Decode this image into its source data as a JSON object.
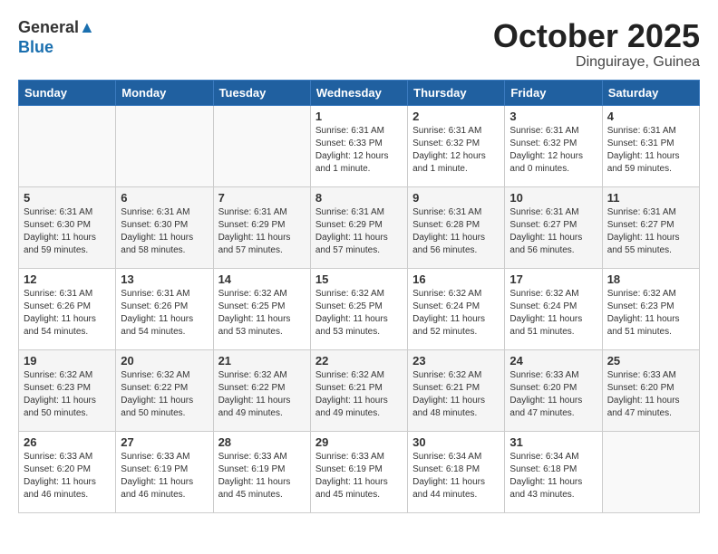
{
  "header": {
    "logo_general": "General",
    "logo_blue": "Blue",
    "month": "October 2025",
    "location": "Dinguiraye, Guinea"
  },
  "weekdays": [
    "Sunday",
    "Monday",
    "Tuesday",
    "Wednesday",
    "Thursday",
    "Friday",
    "Saturday"
  ],
  "weeks": [
    [
      {
        "day": "",
        "content": ""
      },
      {
        "day": "",
        "content": ""
      },
      {
        "day": "",
        "content": ""
      },
      {
        "day": "1",
        "content": "Sunrise: 6:31 AM\nSunset: 6:33 PM\nDaylight: 12 hours\nand 1 minute."
      },
      {
        "day": "2",
        "content": "Sunrise: 6:31 AM\nSunset: 6:32 PM\nDaylight: 12 hours\nand 1 minute."
      },
      {
        "day": "3",
        "content": "Sunrise: 6:31 AM\nSunset: 6:32 PM\nDaylight: 12 hours\nand 0 minutes."
      },
      {
        "day": "4",
        "content": "Sunrise: 6:31 AM\nSunset: 6:31 PM\nDaylight: 11 hours\nand 59 minutes."
      }
    ],
    [
      {
        "day": "5",
        "content": "Sunrise: 6:31 AM\nSunset: 6:30 PM\nDaylight: 11 hours\nand 59 minutes."
      },
      {
        "day": "6",
        "content": "Sunrise: 6:31 AM\nSunset: 6:30 PM\nDaylight: 11 hours\nand 58 minutes."
      },
      {
        "day": "7",
        "content": "Sunrise: 6:31 AM\nSunset: 6:29 PM\nDaylight: 11 hours\nand 57 minutes."
      },
      {
        "day": "8",
        "content": "Sunrise: 6:31 AM\nSunset: 6:29 PM\nDaylight: 11 hours\nand 57 minutes."
      },
      {
        "day": "9",
        "content": "Sunrise: 6:31 AM\nSunset: 6:28 PM\nDaylight: 11 hours\nand 56 minutes."
      },
      {
        "day": "10",
        "content": "Sunrise: 6:31 AM\nSunset: 6:27 PM\nDaylight: 11 hours\nand 56 minutes."
      },
      {
        "day": "11",
        "content": "Sunrise: 6:31 AM\nSunset: 6:27 PM\nDaylight: 11 hours\nand 55 minutes."
      }
    ],
    [
      {
        "day": "12",
        "content": "Sunrise: 6:31 AM\nSunset: 6:26 PM\nDaylight: 11 hours\nand 54 minutes."
      },
      {
        "day": "13",
        "content": "Sunrise: 6:31 AM\nSunset: 6:26 PM\nDaylight: 11 hours\nand 54 minutes."
      },
      {
        "day": "14",
        "content": "Sunrise: 6:32 AM\nSunset: 6:25 PM\nDaylight: 11 hours\nand 53 minutes."
      },
      {
        "day": "15",
        "content": "Sunrise: 6:32 AM\nSunset: 6:25 PM\nDaylight: 11 hours\nand 53 minutes."
      },
      {
        "day": "16",
        "content": "Sunrise: 6:32 AM\nSunset: 6:24 PM\nDaylight: 11 hours\nand 52 minutes."
      },
      {
        "day": "17",
        "content": "Sunrise: 6:32 AM\nSunset: 6:24 PM\nDaylight: 11 hours\nand 51 minutes."
      },
      {
        "day": "18",
        "content": "Sunrise: 6:32 AM\nSunset: 6:23 PM\nDaylight: 11 hours\nand 51 minutes."
      }
    ],
    [
      {
        "day": "19",
        "content": "Sunrise: 6:32 AM\nSunset: 6:23 PM\nDaylight: 11 hours\nand 50 minutes."
      },
      {
        "day": "20",
        "content": "Sunrise: 6:32 AM\nSunset: 6:22 PM\nDaylight: 11 hours\nand 50 minutes."
      },
      {
        "day": "21",
        "content": "Sunrise: 6:32 AM\nSunset: 6:22 PM\nDaylight: 11 hours\nand 49 minutes."
      },
      {
        "day": "22",
        "content": "Sunrise: 6:32 AM\nSunset: 6:21 PM\nDaylight: 11 hours\nand 49 minutes."
      },
      {
        "day": "23",
        "content": "Sunrise: 6:32 AM\nSunset: 6:21 PM\nDaylight: 11 hours\nand 48 minutes."
      },
      {
        "day": "24",
        "content": "Sunrise: 6:33 AM\nSunset: 6:20 PM\nDaylight: 11 hours\nand 47 minutes."
      },
      {
        "day": "25",
        "content": "Sunrise: 6:33 AM\nSunset: 6:20 PM\nDaylight: 11 hours\nand 47 minutes."
      }
    ],
    [
      {
        "day": "26",
        "content": "Sunrise: 6:33 AM\nSunset: 6:20 PM\nDaylight: 11 hours\nand 46 minutes."
      },
      {
        "day": "27",
        "content": "Sunrise: 6:33 AM\nSunset: 6:19 PM\nDaylight: 11 hours\nand 46 minutes."
      },
      {
        "day": "28",
        "content": "Sunrise: 6:33 AM\nSunset: 6:19 PM\nDaylight: 11 hours\nand 45 minutes."
      },
      {
        "day": "29",
        "content": "Sunrise: 6:33 AM\nSunset: 6:19 PM\nDaylight: 11 hours\nand 45 minutes."
      },
      {
        "day": "30",
        "content": "Sunrise: 6:34 AM\nSunset: 6:18 PM\nDaylight: 11 hours\nand 44 minutes."
      },
      {
        "day": "31",
        "content": "Sunrise: 6:34 AM\nSunset: 6:18 PM\nDaylight: 11 hours\nand 43 minutes."
      },
      {
        "day": "",
        "content": ""
      }
    ]
  ]
}
